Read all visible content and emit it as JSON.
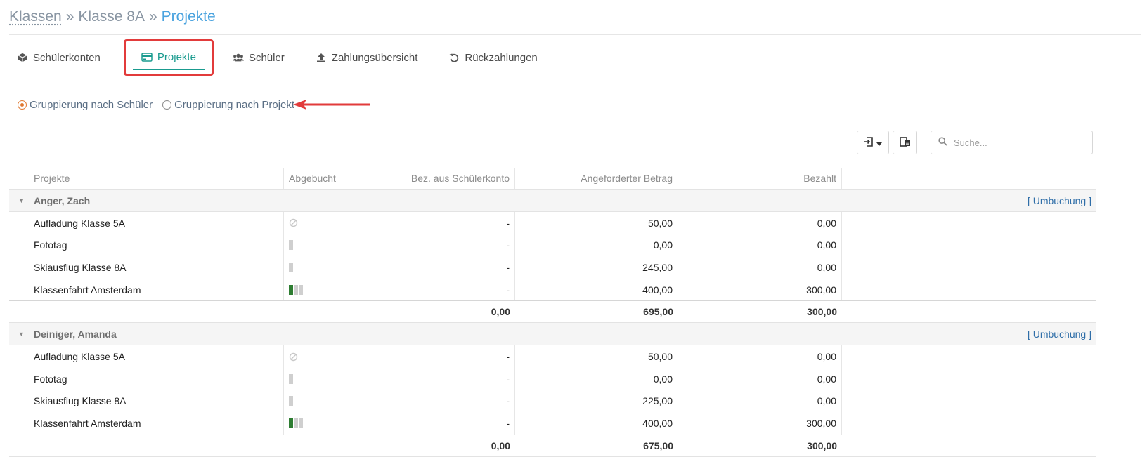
{
  "breadcrumb": {
    "items": [
      "Klassen",
      "Klasse 8A",
      "Projekte"
    ],
    "separator": "»"
  },
  "tabs": [
    {
      "label": "Schülerkonten",
      "icon": "cube-icon"
    },
    {
      "label": "Projekte",
      "icon": "credit-card-icon",
      "active": true
    },
    {
      "label": "Schüler",
      "icon": "users-icon"
    },
    {
      "label": "Zahlungsübersicht",
      "icon": "upload-icon"
    },
    {
      "label": "Rückzahlungen",
      "icon": "undo-icon"
    }
  ],
  "grouping": {
    "by_student": "Gruppierung nach Schüler",
    "by_project": "Gruppierung nach Projekt",
    "selected": "by_student"
  },
  "search": {
    "placeholder": "Suche..."
  },
  "table": {
    "headers": [
      "Projekte",
      "Abgebucht",
      "Bez. aus Schülerkonto",
      "Angeforderter Betrag",
      "Bezahlt"
    ],
    "rebook_label": "[ Umbuchung ]",
    "groups": [
      {
        "name": "Anger, Zach",
        "rows": [
          {
            "project": "Aufladung Klasse 5A",
            "status": "none",
            "bez": "-",
            "angefordert": "50,00",
            "bezahlt": "0,00"
          },
          {
            "project": "Fototag",
            "status": "empty",
            "bez": "-",
            "angefordert": "0,00",
            "bezahlt": "0,00"
          },
          {
            "project": "Skiausflug Klasse 8A",
            "status": "empty",
            "bez": "-",
            "angefordert": "245,00",
            "bezahlt": "0,00"
          },
          {
            "project": "Klassenfahrt Amsterdam",
            "status": "partial",
            "bez": "-",
            "angefordert": "400,00",
            "bezahlt": "300,00"
          }
        ],
        "totals": {
          "bez": "0,00",
          "angefordert": "695,00",
          "bezahlt": "300,00"
        }
      },
      {
        "name": "Deiniger, Amanda",
        "rows": [
          {
            "project": "Aufladung Klasse 5A",
            "status": "none",
            "bez": "-",
            "angefordert": "50,00",
            "bezahlt": "0,00"
          },
          {
            "project": "Fototag",
            "status": "empty",
            "bez": "-",
            "angefordert": "0,00",
            "bezahlt": "0,00"
          },
          {
            "project": "Skiausflug Klasse 8A",
            "status": "empty",
            "bez": "-",
            "angefordert": "225,00",
            "bezahlt": "0,00"
          },
          {
            "project": "Klassenfahrt Amsterdam",
            "status": "partial",
            "bez": "-",
            "angefordert": "400,00",
            "bezahlt": "300,00"
          }
        ],
        "totals": {
          "bez": "0,00",
          "angefordert": "675,00",
          "bezahlt": "300,00"
        }
      }
    ]
  },
  "colors": {
    "accent": "#1a9b8f",
    "highlight": "#e23b3b",
    "radio": "#e0772e",
    "link": "#2f6ea8",
    "paid": "#2e7d32"
  }
}
